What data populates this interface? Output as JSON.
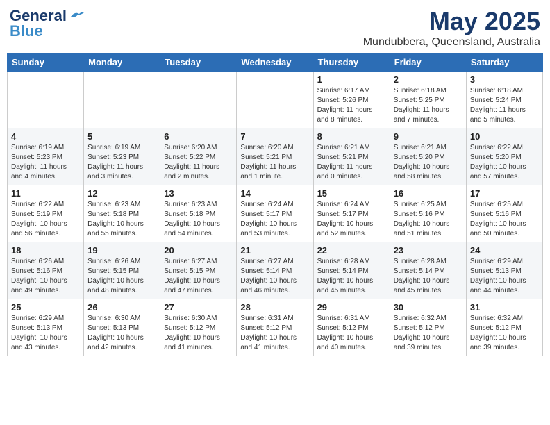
{
  "header": {
    "logo_line1": "General",
    "logo_line2": "Blue",
    "month": "May 2025",
    "location": "Mundubbera, Queensland, Australia"
  },
  "weekdays": [
    "Sunday",
    "Monday",
    "Tuesday",
    "Wednesday",
    "Thursday",
    "Friday",
    "Saturday"
  ],
  "weeks": [
    [
      {
        "day": "",
        "info": ""
      },
      {
        "day": "",
        "info": ""
      },
      {
        "day": "",
        "info": ""
      },
      {
        "day": "",
        "info": ""
      },
      {
        "day": "1",
        "info": "Sunrise: 6:17 AM\nSunset: 5:26 PM\nDaylight: 11 hours\nand 8 minutes."
      },
      {
        "day": "2",
        "info": "Sunrise: 6:18 AM\nSunset: 5:25 PM\nDaylight: 11 hours\nand 7 minutes."
      },
      {
        "day": "3",
        "info": "Sunrise: 6:18 AM\nSunset: 5:24 PM\nDaylight: 11 hours\nand 5 minutes."
      }
    ],
    [
      {
        "day": "4",
        "info": "Sunrise: 6:19 AM\nSunset: 5:23 PM\nDaylight: 11 hours\nand 4 minutes."
      },
      {
        "day": "5",
        "info": "Sunrise: 6:19 AM\nSunset: 5:23 PM\nDaylight: 11 hours\nand 3 minutes."
      },
      {
        "day": "6",
        "info": "Sunrise: 6:20 AM\nSunset: 5:22 PM\nDaylight: 11 hours\nand 2 minutes."
      },
      {
        "day": "7",
        "info": "Sunrise: 6:20 AM\nSunset: 5:21 PM\nDaylight: 11 hours\nand 1 minute."
      },
      {
        "day": "8",
        "info": "Sunrise: 6:21 AM\nSunset: 5:21 PM\nDaylight: 11 hours\nand 0 minutes."
      },
      {
        "day": "9",
        "info": "Sunrise: 6:21 AM\nSunset: 5:20 PM\nDaylight: 10 hours\nand 58 minutes."
      },
      {
        "day": "10",
        "info": "Sunrise: 6:22 AM\nSunset: 5:20 PM\nDaylight: 10 hours\nand 57 minutes."
      }
    ],
    [
      {
        "day": "11",
        "info": "Sunrise: 6:22 AM\nSunset: 5:19 PM\nDaylight: 10 hours\nand 56 minutes."
      },
      {
        "day": "12",
        "info": "Sunrise: 6:23 AM\nSunset: 5:18 PM\nDaylight: 10 hours\nand 55 minutes."
      },
      {
        "day": "13",
        "info": "Sunrise: 6:23 AM\nSunset: 5:18 PM\nDaylight: 10 hours\nand 54 minutes."
      },
      {
        "day": "14",
        "info": "Sunrise: 6:24 AM\nSunset: 5:17 PM\nDaylight: 10 hours\nand 53 minutes."
      },
      {
        "day": "15",
        "info": "Sunrise: 6:24 AM\nSunset: 5:17 PM\nDaylight: 10 hours\nand 52 minutes."
      },
      {
        "day": "16",
        "info": "Sunrise: 6:25 AM\nSunset: 5:16 PM\nDaylight: 10 hours\nand 51 minutes."
      },
      {
        "day": "17",
        "info": "Sunrise: 6:25 AM\nSunset: 5:16 PM\nDaylight: 10 hours\nand 50 minutes."
      }
    ],
    [
      {
        "day": "18",
        "info": "Sunrise: 6:26 AM\nSunset: 5:16 PM\nDaylight: 10 hours\nand 49 minutes."
      },
      {
        "day": "19",
        "info": "Sunrise: 6:26 AM\nSunset: 5:15 PM\nDaylight: 10 hours\nand 48 minutes."
      },
      {
        "day": "20",
        "info": "Sunrise: 6:27 AM\nSunset: 5:15 PM\nDaylight: 10 hours\nand 47 minutes."
      },
      {
        "day": "21",
        "info": "Sunrise: 6:27 AM\nSunset: 5:14 PM\nDaylight: 10 hours\nand 46 minutes."
      },
      {
        "day": "22",
        "info": "Sunrise: 6:28 AM\nSunset: 5:14 PM\nDaylight: 10 hours\nand 45 minutes."
      },
      {
        "day": "23",
        "info": "Sunrise: 6:28 AM\nSunset: 5:14 PM\nDaylight: 10 hours\nand 45 minutes."
      },
      {
        "day": "24",
        "info": "Sunrise: 6:29 AM\nSunset: 5:13 PM\nDaylight: 10 hours\nand 44 minutes."
      }
    ],
    [
      {
        "day": "25",
        "info": "Sunrise: 6:29 AM\nSunset: 5:13 PM\nDaylight: 10 hours\nand 43 minutes."
      },
      {
        "day": "26",
        "info": "Sunrise: 6:30 AM\nSunset: 5:13 PM\nDaylight: 10 hours\nand 42 minutes."
      },
      {
        "day": "27",
        "info": "Sunrise: 6:30 AM\nSunset: 5:12 PM\nDaylight: 10 hours\nand 41 minutes."
      },
      {
        "day": "28",
        "info": "Sunrise: 6:31 AM\nSunset: 5:12 PM\nDaylight: 10 hours\nand 41 minutes."
      },
      {
        "day": "29",
        "info": "Sunrise: 6:31 AM\nSunset: 5:12 PM\nDaylight: 10 hours\nand 40 minutes."
      },
      {
        "day": "30",
        "info": "Sunrise: 6:32 AM\nSunset: 5:12 PM\nDaylight: 10 hours\nand 39 minutes."
      },
      {
        "day": "31",
        "info": "Sunrise: 6:32 AM\nSunset: 5:12 PM\nDaylight: 10 hours\nand 39 minutes."
      }
    ]
  ]
}
